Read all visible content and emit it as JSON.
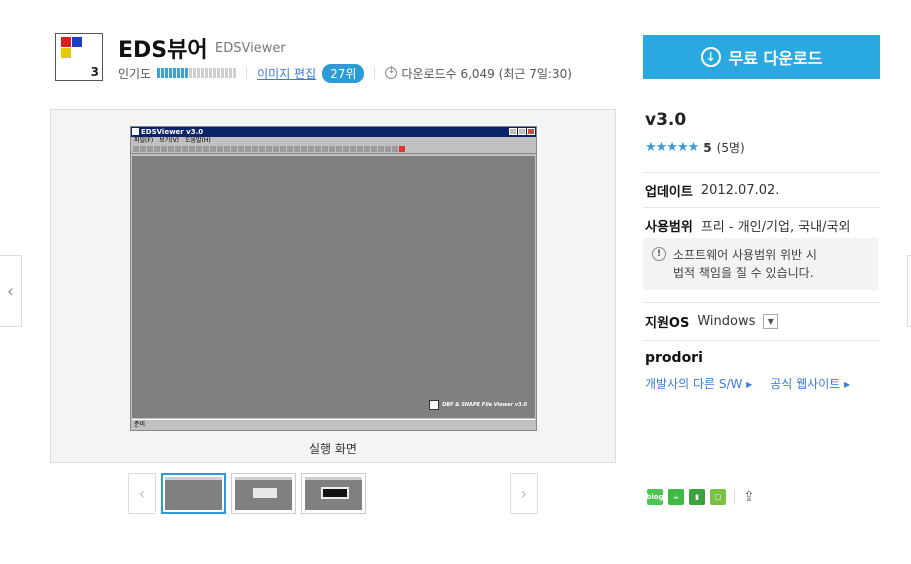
{
  "header": {
    "title": "EDS뷰어",
    "subtitle": "EDSViewer",
    "icon_digit": "3",
    "popularity_label": "인기도",
    "popularity_level": 0.4,
    "image_edit_label": "이미지 편집",
    "rank_badge": "27위",
    "downloads_text": "다운로드수 6,049 (최근 7일:30)"
  },
  "screenshot": {
    "window_title": "EDSViewer v3.0",
    "menu": [
      "파일(F)",
      "보기(V)",
      "도움말(H)"
    ],
    "about_text": "DBF & SHAPE File Viewer v3.0",
    "status": "준비",
    "caption": "실행 화면"
  },
  "thumbnails": {
    "count": 3,
    "active_index": 0
  },
  "sidebar": {
    "download_button": "무료 다운로드",
    "version": "v3.0",
    "rating_stars": "★★★★★",
    "rating_score": "5",
    "rating_count": "(5명)",
    "update_label": "업데이트",
    "update_value": "2012.07.02.",
    "usage_label": "사용범위",
    "usage_value": "프리 - 개인/기업, 국내/국외",
    "warning_line1": "소프트웨어 사용범위 위반 시",
    "warning_line2": "법적 책임을 질 수 있습니다.",
    "os_label": "지원OS",
    "os_value": "Windows",
    "developer": "prodori",
    "developer_links": [
      "개발사의 다른 S/W ▸",
      "공식 웹사이트 ▸"
    ]
  },
  "colors": {
    "accent": "#2aa8e0",
    "link": "#3a7bd5"
  }
}
